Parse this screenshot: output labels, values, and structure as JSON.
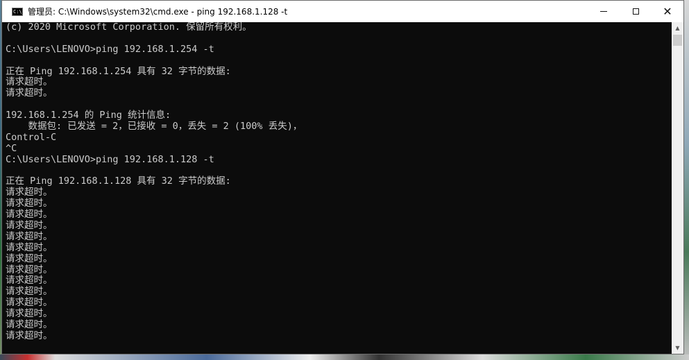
{
  "window": {
    "title": "管理员: C:\\Windows\\system32\\cmd.exe - ping  192.168.1.128 -t",
    "icon": "cmd-icon",
    "icon_text": "C:\\",
    "minimize_icon": "minimize-icon",
    "maximize_icon": "maximize-icon",
    "close_icon": "close-icon"
  },
  "console": {
    "lines": [
      "(c) 2020 Microsoft Corporation. 保留所有权利。",
      "",
      "C:\\Users\\LENOVO>ping 192.168.1.254 -t",
      "",
      "正在 Ping 192.168.1.254 具有 32 字节的数据:",
      "请求超时。",
      "请求超时。",
      "",
      "192.168.1.254 的 Ping 统计信息:",
      "    数据包: 已发送 = 2，已接收 = 0，丢失 = 2 (100% 丢失)，",
      "Control-C",
      "^C",
      "C:\\Users\\LENOVO>ping 192.168.1.128 -t",
      "",
      "正在 Ping 192.168.1.128 具有 32 字节的数据:",
      "请求超时。",
      "请求超时。",
      "请求超时。",
      "请求超时。",
      "请求超时。",
      "请求超时。",
      "请求超时。",
      "请求超时。",
      "请求超时。",
      "请求超时。",
      "请求超时。",
      "请求超时。",
      "请求超时。",
      "请求超时。"
    ]
  },
  "colors": {
    "console_bg": "#0c0c0c",
    "console_fg": "#cccccc",
    "titlebar_bg": "#ffffff"
  }
}
